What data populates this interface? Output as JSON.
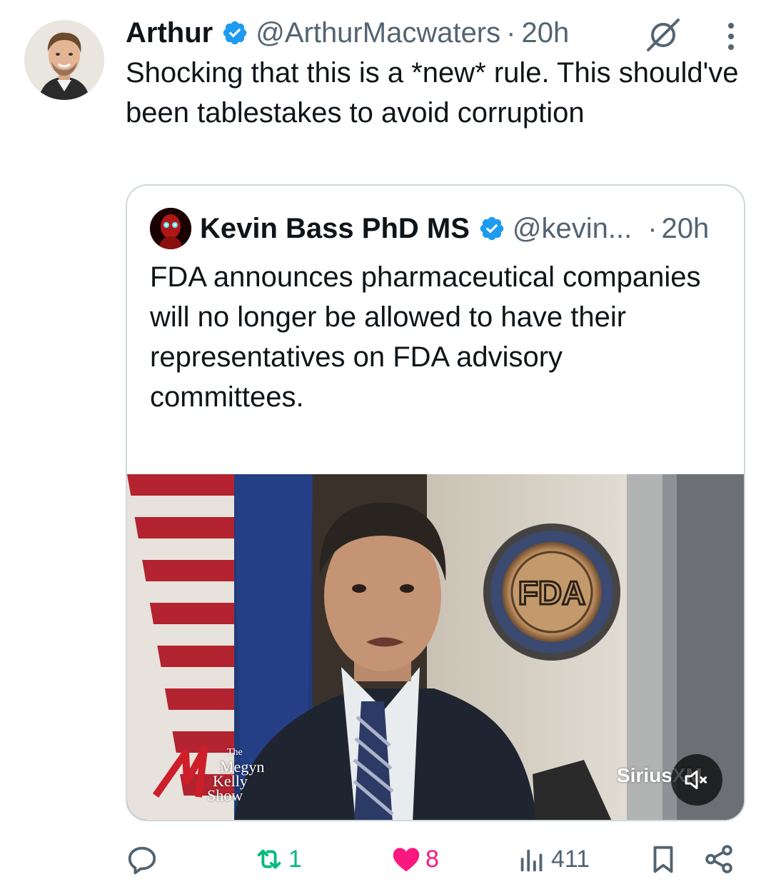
{
  "tweet": {
    "author": {
      "display_name": "Arthur",
      "handle": "@ArthurMacwaters",
      "verified": true
    },
    "separator": "·",
    "timestamp": "20h",
    "text": "Shocking that this is a *new* rule. This should've been tablestakes to avoid corruption",
    "icons": {
      "grok": "grok-icon",
      "more": "more-options-icon"
    }
  },
  "quoted": {
    "author": {
      "display_name": "Kevin Bass PhD MS",
      "handle": "@kevin...",
      "verified": true
    },
    "separator": "·",
    "timestamp": "20h",
    "text": "FDA announces pharmaceutical companies will no longer be allowed to have their representatives on FDA advisory committees.",
    "ellipsis": "...",
    "video": {
      "show_logo": [
        "The",
        "Megyn",
        "Kelly",
        "Show"
      ],
      "watermark": "SiriusXM",
      "seal_text": "FDA",
      "muted": true
    }
  },
  "actions": {
    "reply": {
      "icon": "reply-icon",
      "count": ""
    },
    "repost": {
      "icon": "repost-icon",
      "count": "1"
    },
    "like": {
      "icon": "heart-icon",
      "count": "8",
      "liked": true
    },
    "views": {
      "icon": "views-icon",
      "count": "411"
    },
    "bookmark": {
      "icon": "bookmark-icon"
    },
    "share": {
      "icon": "share-icon"
    }
  },
  "colors": {
    "verified_blue": "#1d9bf0",
    "secondary_text": "#536471",
    "repost_green": "#00ba7c",
    "like_pink": "#f91880",
    "border": "#cfd9de"
  }
}
